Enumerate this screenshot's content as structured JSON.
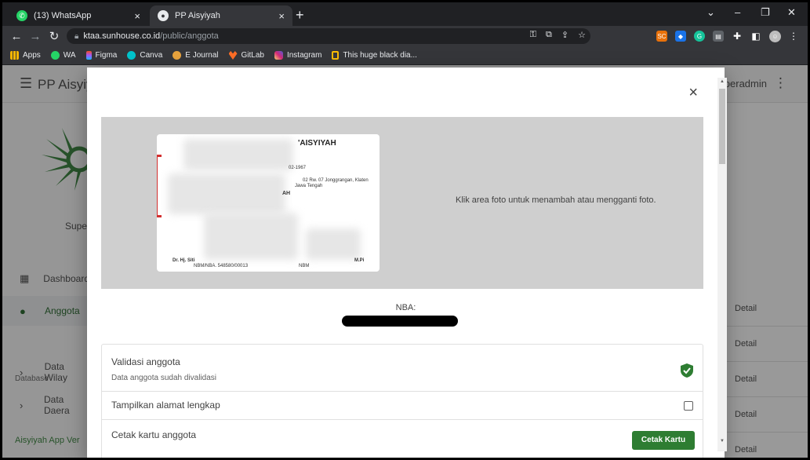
{
  "browser": {
    "tabs": [
      {
        "title": "(13) WhatsApp",
        "icon": "whatsapp-icon",
        "close": "×"
      },
      {
        "title": "PP Aisyiyah",
        "icon": "chrome-icon",
        "close": "×"
      }
    ],
    "new_tab": "+",
    "window_controls": {
      "minimize": "–",
      "restore": "❐",
      "close": "✕",
      "tab_search": "⌄"
    },
    "address": {
      "host": "ktaa.sunhouse.co.id",
      "path": "/public/anggota"
    },
    "bookmarks": [
      {
        "label": "Apps",
        "icon": "apps-grid-icon",
        "color": "#f4b400"
      },
      {
        "label": "WA",
        "icon": "whatsapp-icon",
        "color": "#25d366"
      },
      {
        "label": "Figma",
        "icon": "figma-icon",
        "color": "#f24e1e"
      },
      {
        "label": "Canva",
        "icon": "canva-icon",
        "color": "#00c4cc"
      },
      {
        "label": "E Journal",
        "icon": "ejournal-icon",
        "color": "#e8a33d"
      },
      {
        "label": "GitLab",
        "icon": "gitlab-icon",
        "color": "#fc6d26"
      },
      {
        "label": "Instagram",
        "icon": "instagram-icon",
        "color": "#d6249f"
      },
      {
        "label": "This huge black dia...",
        "icon": "bookmark-note-icon",
        "color": "#fbbc04"
      }
    ]
  },
  "app": {
    "brand": "PP Aisyiy",
    "user": "uperadmin",
    "sidebar": {
      "role": "Supe",
      "items": [
        {
          "label": "Dashboard",
          "icon": "dashboard-icon"
        },
        {
          "label": "Anggota",
          "icon": "person-icon"
        }
      ],
      "section": "Database",
      "sub_items": [
        {
          "label": "Data Wilay",
          "icon": "chevron-right-icon"
        },
        {
          "label": "Data Daera",
          "icon": "chevron-right-icon"
        }
      ],
      "footer": "Aisyiyah App Ver"
    },
    "table_actions": [
      "Detail",
      "Detail",
      "Detail",
      "Detail",
      "Detail"
    ]
  },
  "dialog": {
    "close": "×",
    "card": {
      "org": "'AISYIYAH",
      "line_date": "02-1967",
      "line_address1": "02 Rw. 07 Jonggrangan, Klaten",
      "line_address2": "Jawa Tengah",
      "line_ah": "AH",
      "signer": "Dr. Hj. Siti",
      "signer_right": "M.Pi",
      "nbm_left": "NBM/NBA. 548580/00013",
      "nbm_right": "NBM"
    },
    "photo_hint": "Klik area foto untuk menambah atau mengganti foto.",
    "nba_label": "NBA:",
    "items": [
      {
        "title": "Validasi anggota",
        "subtitle": "Data anggota sudah divalidasi",
        "status": "validated"
      },
      {
        "title": "Tampilkan alamat lengkap",
        "checked": false
      },
      {
        "title": "Cetak kartu anggota",
        "button": "Cetak Kartu"
      }
    ]
  },
  "colors": {
    "primary": "#2e7d32",
    "danger": "#d32f2f"
  }
}
